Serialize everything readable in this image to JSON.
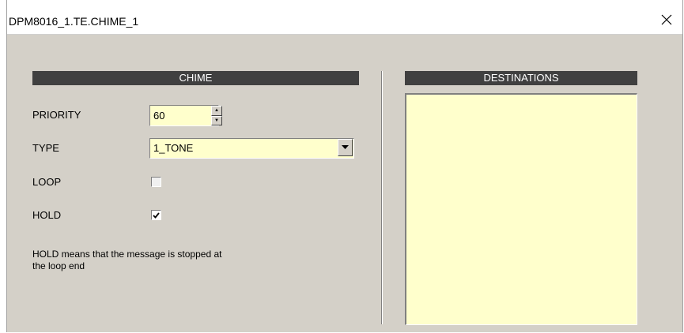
{
  "window": {
    "title": "DPM8016_1.TE.CHIME_1",
    "close_icon": "close-icon"
  },
  "chime": {
    "header": "CHIME",
    "priority": {
      "label": "PRIORITY",
      "value": "60",
      "up_icon": "spin-up-icon",
      "down_icon": "spin-down-icon"
    },
    "type": {
      "label": "TYPE",
      "value": "1_TONE",
      "dropdown_icon": "chevron-down-icon"
    },
    "loop": {
      "label": "LOOP",
      "checked": false,
      "enabled": false
    },
    "hold": {
      "label": "HOLD",
      "checked": true,
      "enabled": true
    },
    "note": "HOLD means that the message is stopped at the loop end"
  },
  "destinations": {
    "header": "DESTINATIONS",
    "items": []
  },
  "colors": {
    "dialog_bg": "#d4d0c8",
    "header_bg": "#404040",
    "field_bg": "#ffffcc"
  }
}
